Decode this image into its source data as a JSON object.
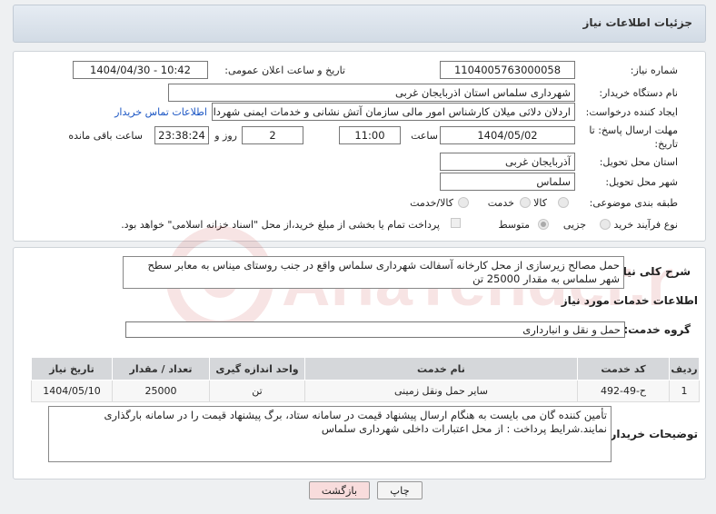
{
  "header": {
    "title": "جزئیات اطلاعات نیاز"
  },
  "fields": {
    "need_number_label": "شماره نیاز:",
    "need_number": "1104005763000058",
    "announce_label": "تاریخ و ساعت اعلان عمومی:",
    "announce_value": "1404/04/30 - 10:42",
    "buyer_org_label": "نام دستگاه خریدار:",
    "buyer_org": "شهرداری سلماس استان اذربایجان غربی",
    "creator_label": "ایجاد کننده درخواست:",
    "creator": "اردلان دلاثی میلان کارشناس امور مالی سازمان آتش نشانی و خدمات ایمنی شهرداری سلماس",
    "contact_link": "اطلاعات تماس خریدار",
    "deadline_label_1": "مهلت ارسال پاسخ: تا",
    "deadline_label_2": "تاریخ:",
    "deadline_date": "1404/05/02",
    "time_label": "ساعت",
    "deadline_time": "11:00",
    "days_value": "2",
    "days_label": "روز و",
    "remaining_time": "23:38:24",
    "remaining_label": "ساعت باقی مانده",
    "province_label": "استان محل تحویل:",
    "province": "آذربایجان غربی",
    "city_label": "شهر محل تحویل:",
    "city": "سلماس",
    "category_label": "طبقه بندی موضوعی:",
    "category_options": [
      "کالا",
      "خدمت",
      "کالا/خدمت"
    ],
    "process_label": "نوع فرآیند خرید :",
    "process_options": [
      "جزیی",
      "متوسط"
    ],
    "payment_note": "پرداخت تمام یا بخشی از مبلغ خرید،از محل \"اسناد خزانه اسلامی\" خواهد بود."
  },
  "summary": {
    "label": "شرح کلی نیاز:",
    "text": "حمل مصالح زیرسازی از محل کارخانه آسفالت شهرداری سلماس واقع در جنب روستای میناس به معابر سطح شهر سلماس  به مقدار 25000 تن"
  },
  "services": {
    "section_title": "اطلاعات خدمات مورد نیاز",
    "group_label": "گروه خدمت:",
    "group_value": "حمل و نقل و انبارداری",
    "columns": [
      "ردیف",
      "کد خدمت",
      "نام خدمت",
      "واحد اندازه گیری",
      "تعداد / مقدار",
      "تاریخ نیاز"
    ],
    "rows": [
      [
        "1",
        "ح-49-492",
        "سایر حمل ونقل زمینی",
        "تن",
        "25000",
        "1404/05/10"
      ]
    ]
  },
  "notes": {
    "label": "توضیحات خریدار:",
    "text": "تأمین کننده گان می بایست به هنگام ارسال پیشنهاد قیمت در سامانه ستاد، برگ پیشنهاد قیمت را در سامانه بارگذاری نمایند.شرایط پرداخت : از محل اعتبارات داخلی شهرداری سلماس"
  },
  "buttons": {
    "print": "چاپ",
    "back": "بازگشت"
  },
  "watermark": {
    "text": "AriaTender.neT"
  },
  "colors": {
    "link": "#1a55c4",
    "back_button_bg": "#f8dcdc",
    "watermark": "#c62828"
  }
}
